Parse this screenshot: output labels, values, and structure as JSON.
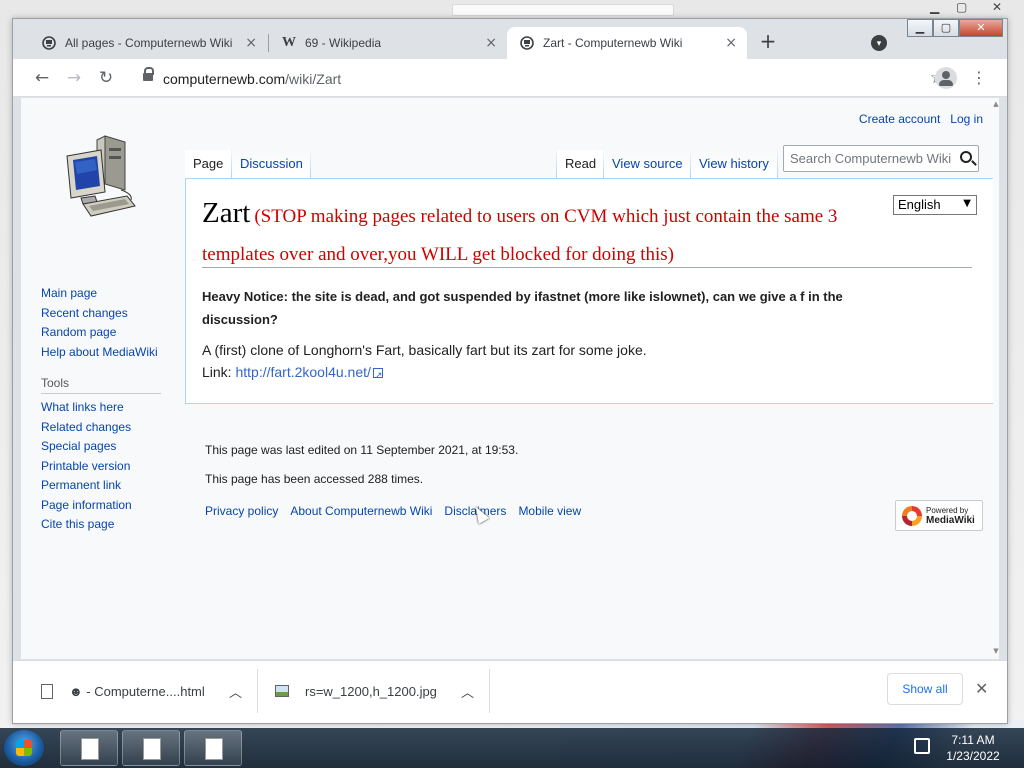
{
  "tabs": [
    {
      "title": "All pages - Computernewb Wiki",
      "icon": "computer-favicon",
      "active": false
    },
    {
      "title": "69 - Wikipedia",
      "icon": "wikipedia-favicon",
      "active": false
    },
    {
      "title": "Zart - Computernewb Wiki",
      "icon": "computer-favicon",
      "active": true
    }
  ],
  "tab_close_glyph": "×",
  "newtab_glyph": "+",
  "toolbar": {
    "back_glyph": "←",
    "forward_glyph": "→",
    "reload_glyph": "↻",
    "url_host": "computernewb.com",
    "url_path": "/wiki/Zart",
    "star_glyph": "☆",
    "menu_glyph": "⋮"
  },
  "wiki": {
    "personal": {
      "create_account": "Create account",
      "log_in": "Log in"
    },
    "page_tabs": {
      "page": "Page",
      "discussion": "Discussion",
      "read": "Read",
      "view_source": "View source",
      "view_history": "View history"
    },
    "search_placeholder": "Search Computernewb Wiki",
    "navigation": [
      "Main page",
      "Recent changes",
      "Random page",
      "Help about MediaWiki"
    ],
    "tools_heading": "Tools",
    "tools": [
      "What links here",
      "Related changes",
      "Special pages",
      "Printable version",
      "Permanent link",
      "Page information",
      "Cite this page"
    ],
    "language": "English",
    "title": "Zart",
    "title_warning": "(STOP making pages related to users on CVM which just contain the same 3 templates over and over,you WILL get blocked for doing this)",
    "notice": "Heavy Notice: the site is dead, and got suspended by ifastnet (more like islownet), can we give a f in the discussion?",
    "body_text": "A (first) clone of Longhorn's Fart, basically fart but its zart for some joke.",
    "link_label": "Link: ",
    "link_url": "http://fart.2kool4u.net/",
    "last_edited": "This page was last edited on 11 September 2021, at 19:53.",
    "accessed": "This page has been accessed 288 times.",
    "footer_links": [
      "Privacy policy",
      "About Computernewb Wiki",
      "Disclaimers",
      "Mobile view"
    ],
    "powered_by": "Powered by",
    "powered_name": "MediaWiki"
  },
  "downloads": [
    {
      "name": "☻ - Computerne....html",
      "icon": "file-icon"
    },
    {
      "name": "rs=w_1200,h_1200.jpg",
      "icon": "image-file-icon"
    }
  ],
  "show_all": "Show all",
  "shelf_close": "✕",
  "window_buttons": {
    "minimize": "▁",
    "maximize": "▢",
    "close": "✕"
  },
  "taskbar": {
    "time": "7:11 AM",
    "date": "1/23/2022"
  },
  "colors": {
    "link": "#0645ad",
    "warning_red": "#d00000",
    "chrome_frame": "#dee1e6",
    "accent_blue": "#1a73e8"
  }
}
